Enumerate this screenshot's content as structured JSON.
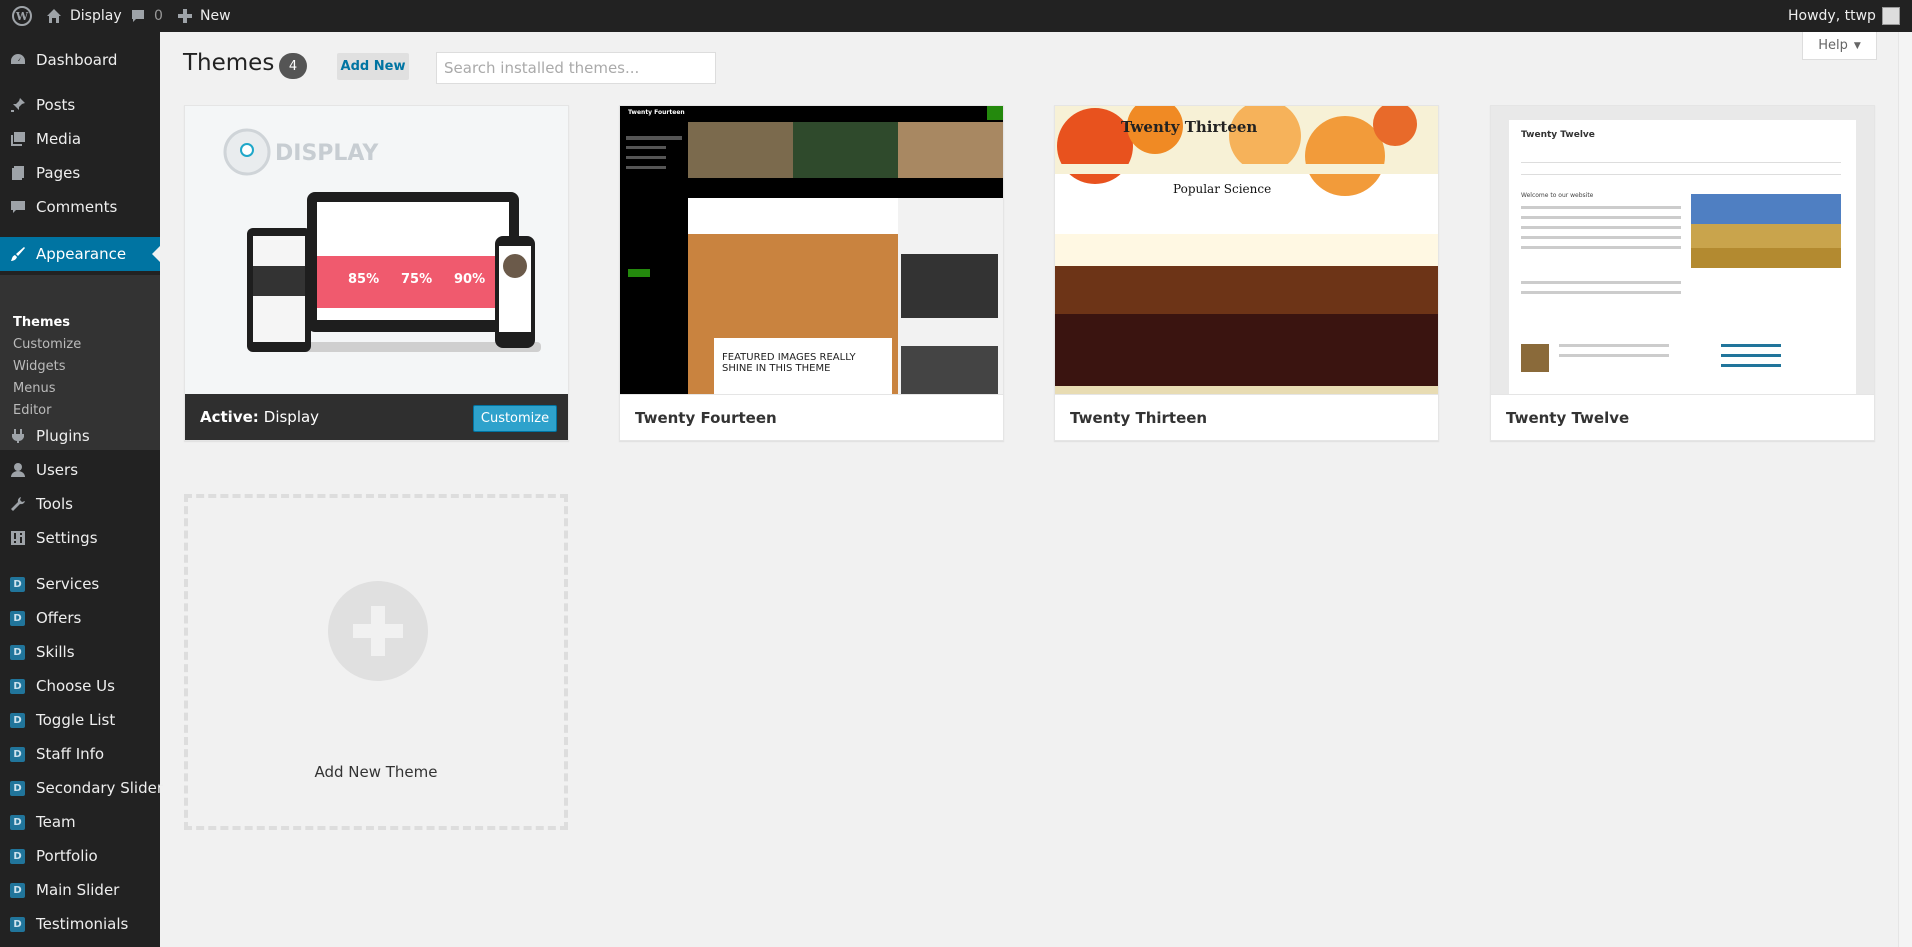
{
  "adminbar": {
    "site_name": "Display",
    "comments_count": "0",
    "new_label": "New",
    "greeting": "Howdy, ttwp"
  },
  "sidebar": {
    "items": [
      {
        "label": "Dashboard",
        "icon": "dashboard-icon"
      },
      {
        "label": "Posts",
        "icon": "pin-icon"
      },
      {
        "label": "Media",
        "icon": "media-icon"
      },
      {
        "label": "Pages",
        "icon": "pages-icon"
      },
      {
        "label": "Comments",
        "icon": "comment-icon"
      },
      {
        "label": "Appearance",
        "icon": "brush-icon"
      },
      {
        "label": "Plugins",
        "icon": "plug-icon"
      },
      {
        "label": "Users",
        "icon": "user-icon"
      },
      {
        "label": "Tools",
        "icon": "wrench-icon"
      },
      {
        "label": "Settings",
        "icon": "settings-icon"
      },
      {
        "label": "Services",
        "icon": "d-icon"
      },
      {
        "label": "Offers",
        "icon": "d-icon"
      },
      {
        "label": "Skills",
        "icon": "d-icon"
      },
      {
        "label": "Choose Us",
        "icon": "d-icon"
      },
      {
        "label": "Toggle List",
        "icon": "d-icon"
      },
      {
        "label": "Staff Info",
        "icon": "d-icon"
      },
      {
        "label": "Secondary Slider",
        "icon": "d-icon"
      },
      {
        "label": "Team",
        "icon": "d-icon"
      },
      {
        "label": "Portfolio",
        "icon": "d-icon"
      },
      {
        "label": "Main Slider",
        "icon": "d-icon"
      },
      {
        "label": "Testimonials",
        "icon": "d-icon"
      }
    ],
    "d_letter": "D",
    "submenu": [
      "Themes",
      "Customize",
      "Widgets",
      "Menus",
      "Editor"
    ]
  },
  "header": {
    "title": "Themes",
    "count": "4",
    "add_new": "Add New",
    "search_placeholder": "Search installed themes...",
    "help": "Help"
  },
  "themes": {
    "active_label": "Active:",
    "active_name": "Display",
    "customize": "Customize",
    "items": [
      "Twenty Fourteen",
      "Twenty Thirteen",
      "Twenty Twelve"
    ]
  },
  "screenshots": {
    "display_logo": "DISPLAY",
    "stats": [
      "85%",
      "75%",
      "90%"
    ],
    "fourteen_site": "Twenty Fourteen",
    "fourteen_featured": "FEATURED IMAGES REALLY SHINE IN THIS THEME",
    "thirteen_site": "Twenty Thirteen",
    "thirteen_post": "Popular Science",
    "twelve_site": "Twenty Twelve",
    "twelve_welcome": "Welcome to our website"
  },
  "add_new_theme": "Add New Theme",
  "colors": {
    "accent": "#0074a2",
    "button": "#2ea2cc",
    "sidebar": "#222222"
  }
}
